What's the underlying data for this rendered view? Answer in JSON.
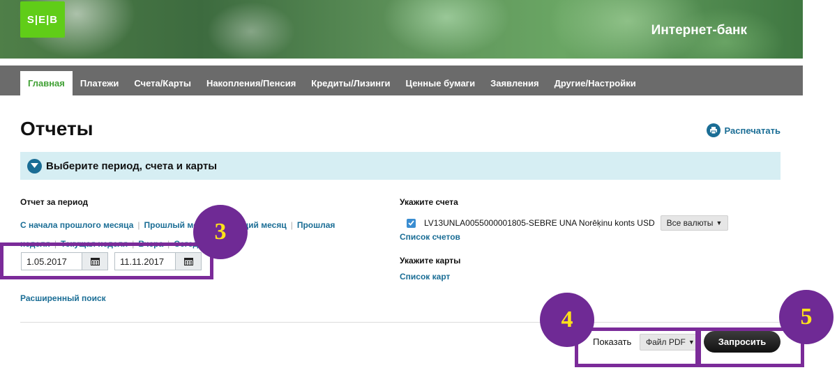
{
  "header": {
    "logo_text": "S|E|B",
    "title": "Интернет-банк"
  },
  "nav": {
    "items": [
      {
        "label": "Главная",
        "active": true
      },
      {
        "label": "Платежи"
      },
      {
        "label": "Счета/Карты"
      },
      {
        "label": "Накопления/Пенсия"
      },
      {
        "label": "Кредиты/Лизинги"
      },
      {
        "label": "Ценные бумаги"
      },
      {
        "label": "Заявления"
      },
      {
        "label": "Другие/Настройки"
      }
    ]
  },
  "page": {
    "title": "Отчеты",
    "print_label": "Распечатать",
    "section_title": "Выберите период, счета и карты"
  },
  "period": {
    "label": "Отчет за период",
    "links": [
      "С начала прошлого месяца",
      "Прошлый месяц",
      "Текущий месяц",
      "Прошлая неделя",
      "Текущая неделя",
      "Вчера",
      "Сегодня"
    ],
    "from": "1.05.2017",
    "to": "11.11.2017",
    "advanced_search": "Расширенный поиск"
  },
  "accounts": {
    "label": "Укажите счета",
    "account": "LV13UNLA0055000001805-SEBRE UNA Norēķinu konts USD",
    "currency_select": "Все валюты",
    "list_link": "Список счетов",
    "checked": true
  },
  "cards": {
    "label": "Укажите карты",
    "list_link": "Список карт"
  },
  "actions": {
    "show_label": "Показать",
    "format": "Файл PDF",
    "submit": "Запросить"
  },
  "annotations": {
    "badge_3": "3",
    "badge_4": "4",
    "badge_5": "5"
  },
  "colors": {
    "accent_green": "#41a135",
    "link_blue": "#1a6d95",
    "annotation_purple": "#6f2a95",
    "annotation_digit": "#ffe21a"
  }
}
